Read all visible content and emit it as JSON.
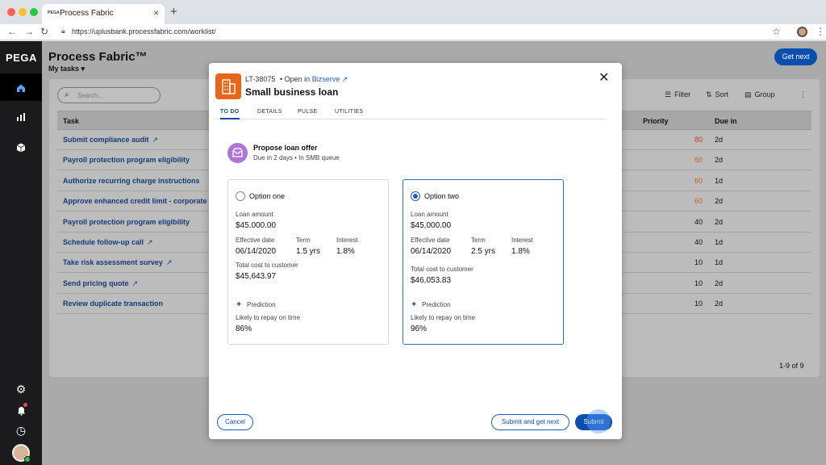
{
  "browser": {
    "tab_favicon": "PEGA",
    "tab_title": "Process Fabric",
    "tab_close": "×",
    "new_tab": "+",
    "url": "https://uplusbank.processfabric.com/worklist/"
  },
  "sidebar": {
    "logo": "PEGA",
    "items": [
      "home-icon",
      "chart-icon",
      "cube-icon"
    ],
    "bottom": [
      "gear-icon",
      "bell-icon",
      "clock-icon",
      "avatar"
    ]
  },
  "header": {
    "title": "Process Fabric™",
    "view": "My tasks",
    "get_next": "Get next"
  },
  "worklist": {
    "search_placeholder": "Search...",
    "filter": "Filter",
    "sort": "Sort",
    "group": "Group",
    "columns": {
      "task": "Task",
      "priority": "Priority",
      "due": "Due in"
    },
    "rows": [
      {
        "task": "Submit compliance audit",
        "ext": true,
        "priority": "80",
        "due": "2d",
        "color": "#c0392b"
      },
      {
        "task": "Payroll protection program eligibility",
        "ext": false,
        "priority": "60",
        "due": "2d",
        "color": "#c0641a"
      },
      {
        "task": "Authorize recurring charge instructions",
        "ext": false,
        "priority": "60",
        "due": "1d",
        "color": "#c0641a"
      },
      {
        "task": "Approve enhanced credit limit  - corporate p",
        "ext": false,
        "priority": "60",
        "due": "2d",
        "color": "#c0641a"
      },
      {
        "task": "Payroll protection program eligibility",
        "ext": false,
        "priority": "40",
        "due": "2d",
        "color": "#111111"
      },
      {
        "task": "Schedule follow-up call",
        "ext": true,
        "priority": "40",
        "due": "1d",
        "color": "#111111"
      },
      {
        "task": "Take risk assessment survey",
        "ext": true,
        "priority": "10",
        "due": "1d",
        "color": "#111111"
      },
      {
        "task": "Send pricing quote",
        "ext": true,
        "priority": "10",
        "due": "2d",
        "color": "#111111"
      },
      {
        "task": "Review duplicate transaction",
        "ext": false,
        "priority": "10",
        "due": "2d",
        "color": "#111111"
      }
    ],
    "pager": "1-9 of 9"
  },
  "modal": {
    "case_id": "LT-38075",
    "open_in_prefix": "• Open in",
    "open_in_app": "Bizserve",
    "title": "Small business loan",
    "tabs": [
      "TO DO",
      "DETAILS",
      "PULSE",
      "UTILITIES"
    ],
    "step": {
      "title": "Propose loan offer",
      "sub": "Due in 2 days  • In SMB queue"
    },
    "labels": {
      "loan_amount": "Loan amount",
      "effective_date": "Effective date",
      "term": "Term",
      "interest": "Interest",
      "total_cost": "Total cost to customer",
      "prediction": "Prediction",
      "likely": "Likely to repay on time"
    },
    "options": [
      {
        "name": "Option one",
        "selected": false,
        "loan_amount": "$45,000.00",
        "effective_date": "06/14/2020",
        "term": "1.5 yrs",
        "interest": "1.8%",
        "total_cost": "$45,643.97",
        "repay": "86%"
      },
      {
        "name": "Option two",
        "selected": true,
        "loan_amount": "$45,000.00",
        "effective_date": "06/14/2020",
        "term": "2.5 yrs",
        "interest": "1.8%",
        "total_cost": "$46,053.83",
        "repay": "96%"
      }
    ],
    "cancel": "Cancel",
    "submit_next": "Submit and get next",
    "submit": "Submit"
  },
  "colors": {
    "brand": "#0a4fb0",
    "case_icon": "#e8661a",
    "step_icon": "#b074d6"
  }
}
